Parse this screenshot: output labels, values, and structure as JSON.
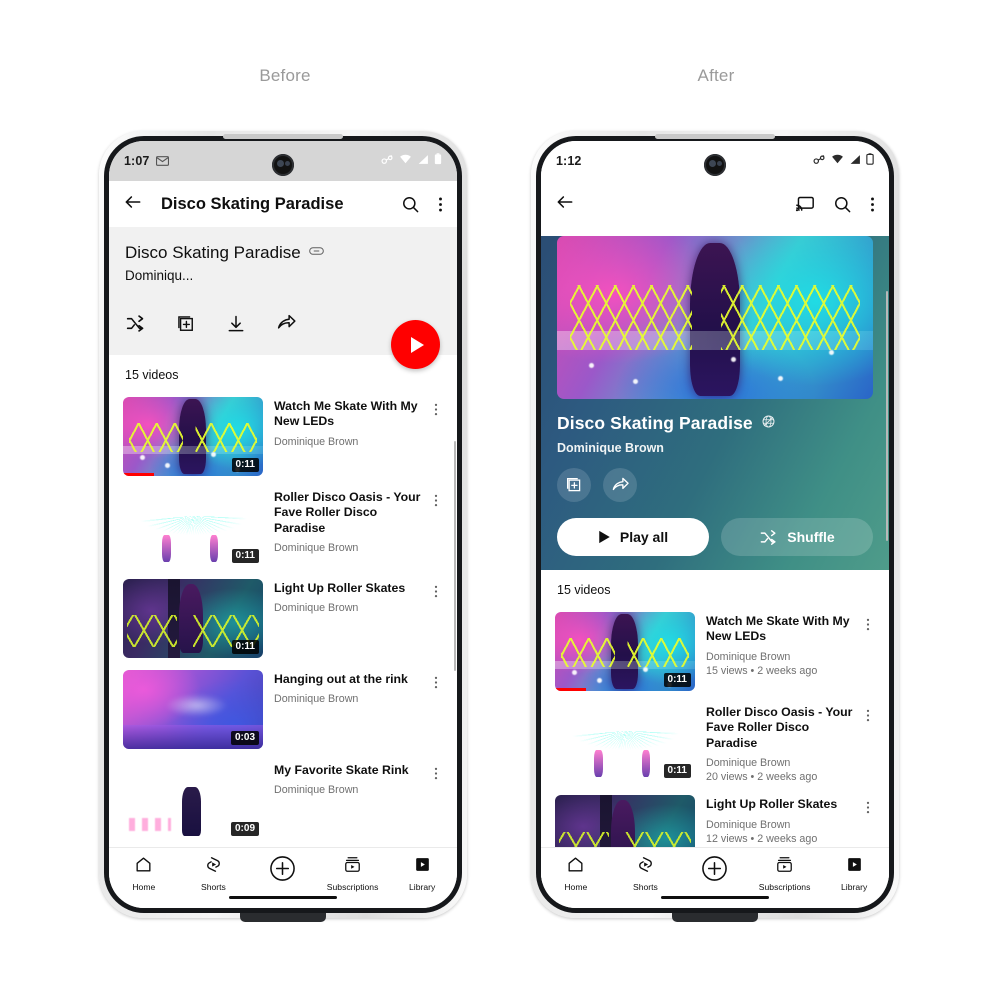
{
  "captions": {
    "before": "Before",
    "after": "After"
  },
  "before": {
    "status": {
      "time": "1:07",
      "gmail_icon": "gmail-icon",
      "icons": [
        "cast-connected-icon",
        "wifi-icon",
        "signal-icon",
        "battery-icon"
      ]
    },
    "appbar": {
      "back_icon": "back-arrow-icon",
      "title": "Disco Skating Paradise",
      "search_icon": "search-icon",
      "overflow_icon": "more-vert-icon"
    },
    "playlist": {
      "title": "Disco Skating Paradise",
      "privacy_icon": "link-icon",
      "owner": "Dominiqu...",
      "actions": [
        "shuffle-icon",
        "save-to-library-icon",
        "download-icon",
        "share-icon"
      ],
      "play_button": "play-fab"
    },
    "videos_count": "15 videos",
    "videos": [
      {
        "title": "Watch Me Skate With My New LEDs",
        "channel": "Dominique Brown",
        "duration": "0:11",
        "art": "art-neon",
        "progress": true
      },
      {
        "title": "Roller Disco Oasis - Your Fave Roller Disco Paradise",
        "channel": "Dominique Brown",
        "duration": "0:11",
        "art": "art-orb",
        "progress": false
      },
      {
        "title": "Light Up Roller Skates",
        "channel": "Dominique Brown",
        "duration": "0:11",
        "art": "art-dark",
        "progress": false
      },
      {
        "title": "Hanging out at the rink",
        "channel": "Dominique Brown",
        "duration": "0:03",
        "art": "art-haze",
        "progress": false
      },
      {
        "title": "My Favorite Skate Rink",
        "channel": "Dominique Brown",
        "duration": "0:09",
        "art": "art-rink",
        "progress": false
      }
    ],
    "nav": [
      {
        "label": "Home",
        "icon": "home-icon"
      },
      {
        "label": "Shorts",
        "icon": "shorts-icon"
      },
      {
        "label": "",
        "icon": "create-plus-icon"
      },
      {
        "label": "Subscriptions",
        "icon": "subscriptions-icon"
      },
      {
        "label": "Library",
        "icon": "library-icon"
      }
    ]
  },
  "after": {
    "status": {
      "time": "1:12",
      "icons": [
        "cast-connected-icon",
        "wifi-icon",
        "signal-icon",
        "battery-icon"
      ]
    },
    "appbar": {
      "back_icon": "back-arrow-icon",
      "cast_icon": "cast-icon",
      "search_icon": "search-icon",
      "overflow_icon": "more-vert-icon"
    },
    "hero": {
      "title": "Disco Skating Paradise",
      "privacy_icon": "unlisted-globe-icon",
      "owner": "Dominique Brown",
      "icon_buttons": [
        "save-to-library-icon",
        "share-icon"
      ],
      "play_all_label": "Play all",
      "shuffle_label": "Shuffle"
    },
    "videos_count": "15 videos",
    "videos": [
      {
        "title": "Watch Me Skate With My New LEDs",
        "channel": "Dominique Brown",
        "stats": "15 views • 2 weeks ago",
        "duration": "0:11",
        "art": "art-neon",
        "progress": true
      },
      {
        "title": "Roller Disco Oasis - Your Fave Roller Disco Paradise",
        "channel": "Dominique Brown",
        "stats": "20 views • 2 weeks ago",
        "duration": "0:11",
        "art": "art-orb",
        "progress": false
      },
      {
        "title": "Light Up Roller Skates",
        "channel": "Dominique Brown",
        "stats": "12 views • 2 weeks ago",
        "duration": "0:11",
        "art": "art-dark",
        "progress": false
      }
    ],
    "nav": [
      {
        "label": "Home",
        "icon": "home-icon"
      },
      {
        "label": "Shorts",
        "icon": "shorts-icon"
      },
      {
        "label": "",
        "icon": "create-plus-icon"
      },
      {
        "label": "Subscriptions",
        "icon": "subscriptions-icon"
      },
      {
        "label": "Library",
        "icon": "library-icon"
      }
    ]
  },
  "colors": {
    "youtube_red": "#ff0000",
    "text_primary": "#0f0f0f",
    "text_secondary": "#707070",
    "caption_grey": "#9a9a9a"
  }
}
